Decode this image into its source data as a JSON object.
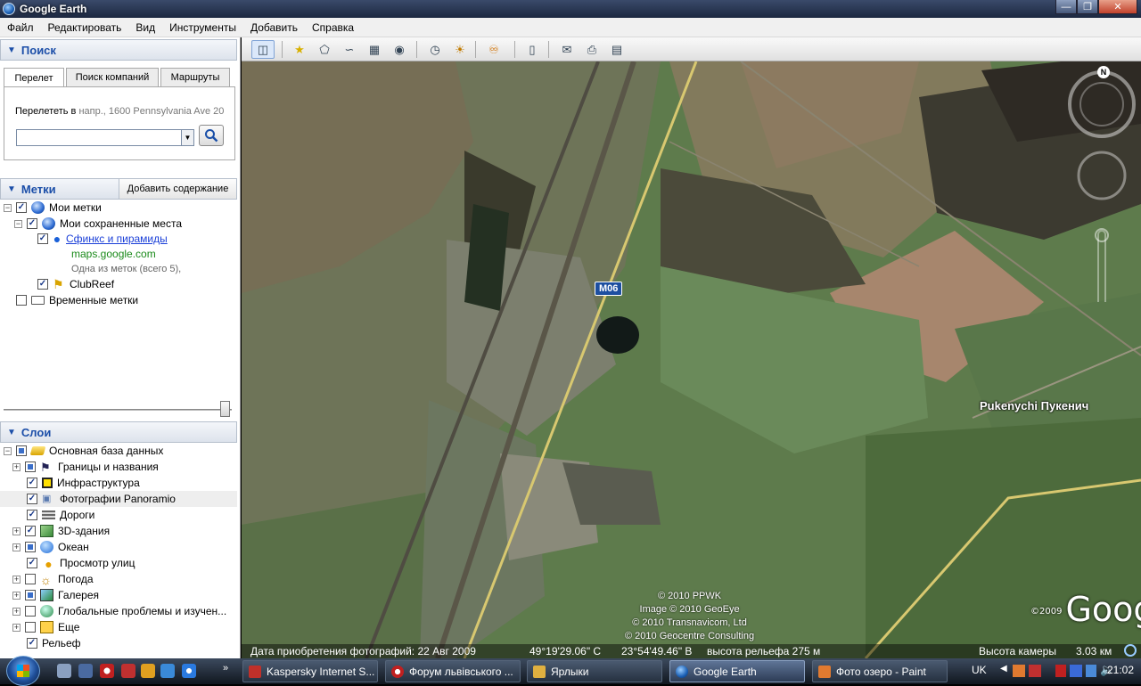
{
  "window": {
    "title": "Google Earth"
  },
  "menu": [
    "Файл",
    "Редактировать",
    "Вид",
    "Инструменты",
    "Добавить",
    "Справка"
  ],
  "search": {
    "header": "Поиск",
    "tabs": [
      "Перелет",
      "Поиск компаний",
      "Маршруты"
    ],
    "fly_label": "Перелететь в",
    "fly_placeholder": "напр., 1600 Pennsylvania Ave 20",
    "fly_value": ""
  },
  "places": {
    "header": "Метки",
    "add_button": "Добавить содержание",
    "items": [
      {
        "label": "Мои метки",
        "checked": true,
        "icon": "globe-icon"
      },
      {
        "label": "Мои сохраненные места",
        "checked": true,
        "icon": "globe-icon"
      },
      {
        "label": "Сфинкс и пирамиды",
        "checked": true,
        "icon": "placemark-pin-icon",
        "link": true
      },
      {
        "label": "maps.google.com",
        "icon": "none"
      },
      {
        "label": "Одна из меток (всего 5),",
        "icon": "none"
      },
      {
        "label": "ClubReef",
        "checked": true,
        "icon": "placemark-yellow-icon"
      },
      {
        "label": "Временные метки",
        "checked": false,
        "icon": "folder-icon"
      }
    ]
  },
  "layers": {
    "header": "Слои",
    "items": [
      {
        "label": "Основная база данных",
        "state": "partial",
        "icon": "database-icon"
      },
      {
        "label": "Границы и названия",
        "state": "partial",
        "icon": "flag-icon"
      },
      {
        "label": "Инфраструктура",
        "state": "checked",
        "icon": "poi-icon"
      },
      {
        "label": "Фотографии Panoramio",
        "state": "checked",
        "icon": "panoramio-icon"
      },
      {
        "label": "Дороги",
        "state": "checked",
        "icon": "roads-icon"
      },
      {
        "label": "3D-здания",
        "state": "checked",
        "icon": "buildings-icon"
      },
      {
        "label": "Океан",
        "state": "partial",
        "icon": "ocean-icon"
      },
      {
        "label": "Просмотр улиц",
        "state": "checked",
        "icon": "pegman-icon"
      },
      {
        "label": "Погода",
        "state": "unchecked",
        "icon": "weather-icon"
      },
      {
        "label": "Галерея",
        "state": "partial",
        "icon": "gallery-icon"
      },
      {
        "label": "Глобальные проблемы и изучен...",
        "state": "unchecked",
        "icon": "global-awareness-icon"
      },
      {
        "label": "Еще",
        "state": "unchecked",
        "icon": "more-icon"
      },
      {
        "label": "Рельеф",
        "state": "checked",
        "icon": "none"
      }
    ]
  },
  "toolbar": {
    "icons": [
      "sidebar-toggle-icon",
      "add-placemark-icon",
      "add-polygon-icon",
      "add-path-icon",
      "add-overlay-icon",
      "record-tour-icon",
      "historical-imagery-icon",
      "sunlight-icon",
      "planets-icon",
      "ruler-icon",
      "email-icon",
      "print-icon",
      "view-in-maps-icon"
    ]
  },
  "map": {
    "road_label": "M06",
    "place_label": "Pukenychi  Пукенич",
    "copyright": [
      "© 2010 PPWK",
      "Image © 2010 GeoEye",
      "© 2010 Transnavicom, Ltd",
      "© 2010 Geocentre Consulting"
    ],
    "logo_year": "©2009",
    "logo_text": "Google",
    "status_date": "Дата приобретения фотографий: 22 Авг 2009",
    "status_lat": "49°19'29.06\" С",
    "status_lon": "23°54'49.46\" В",
    "status_elev": "высота рельефа  275 м",
    "status_eye": "Высота камеры",
    "status_eye_val": "3.03 км",
    "compass_n": "N"
  },
  "taskbar": {
    "tasks": [
      {
        "label": "Kaspersky Internet S...",
        "color": "#c0302a"
      },
      {
        "label": "Форум львівського ...",
        "color": "#c02020"
      },
      {
        "label": "Ярлыки",
        "color": "#e0b040"
      },
      {
        "label": "Google Earth",
        "color": "#3c7ad8"
      },
      {
        "label": "Фото озеро - Paint",
        "color": "#e07a30"
      }
    ],
    "lang": "UK",
    "clock": "21:02"
  }
}
